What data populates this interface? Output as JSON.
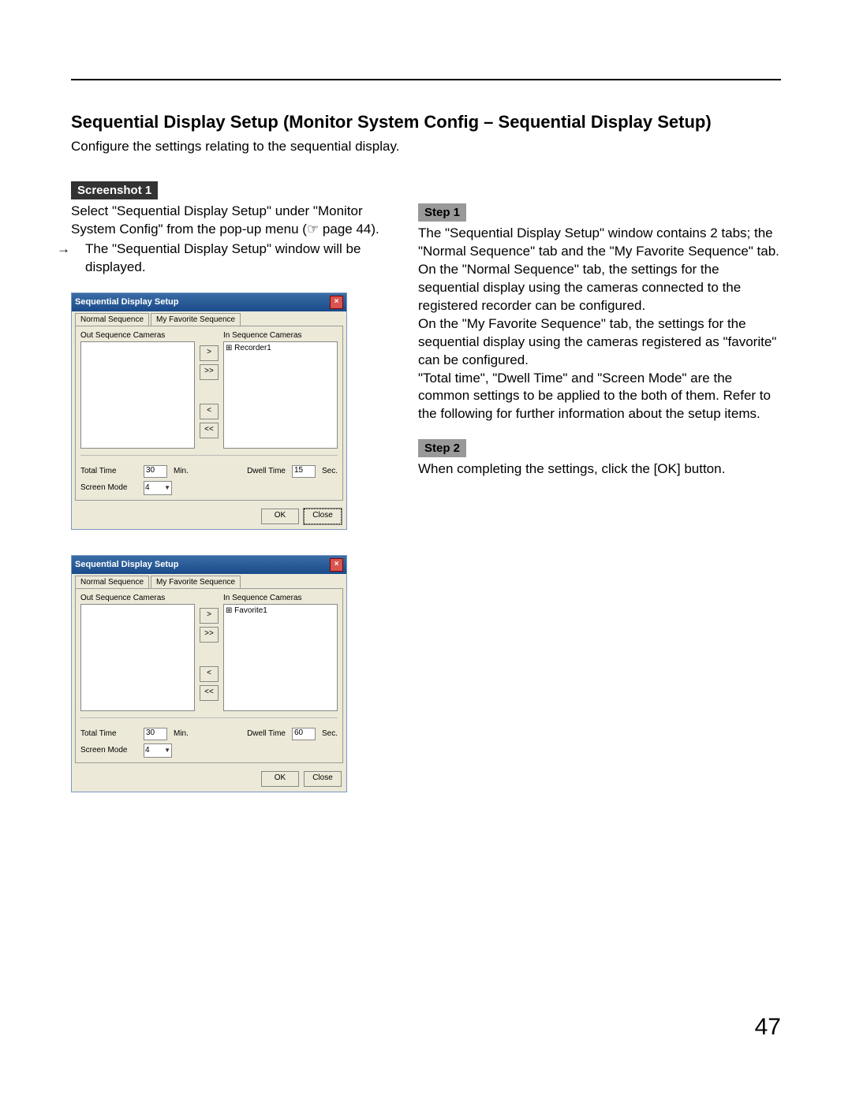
{
  "page": {
    "section_title": "Sequential Display Setup (Monitor System Config – Sequential Display Setup)",
    "intro": "Configure the settings relating to the sequential display.",
    "page_number": "47"
  },
  "screenshot_tag": "Screenshot 1",
  "screenshot_text_a": "Select \"Sequential Display Setup\" under \"Monitor System Config\" from the pop-up menu (☞ page 44).",
  "screenshot_text_b": "The \"Sequential Display Setup\" window will be displayed.",
  "step1_tag": "Step 1",
  "step1_text": "The \"Sequential Display Setup\" window contains 2 tabs; the \"Normal Sequence\" tab and the \"My Favorite Sequence\" tab.\nOn the \"Normal Sequence\" tab, the settings for the sequential display using the cameras connected to the registered recorder can be configured.\nOn the \"My Favorite Sequence\" tab, the settings for the sequential display using the cameras registered as \"favorite\" can be configured.\n\"Total time\", \"Dwell Time\" and \"Screen Mode\" are the common settings to be applied to the both of them. Refer to the following for further information about the setup items.",
  "step2_tag": "Step 2",
  "step2_text": "When completing the settings, click the [OK] button.",
  "dialog": {
    "title": "Sequential Display Setup",
    "tab_normal": "Normal Sequence",
    "tab_favorite": "My Favorite Sequence",
    "out_label": "Out Sequence Cameras",
    "in_label": "In Sequence Cameras",
    "tree_recorder": "Recorder1",
    "tree_favorite": "Favorite1",
    "btn_right": ">",
    "btn_right_all": ">>",
    "btn_left": "<",
    "btn_left_all": "<<",
    "total_time": "Total Time",
    "total_time_val1": "30",
    "total_time_unit": "Min.",
    "dwell_time": "Dwell Time",
    "dwell_time_val1": "15",
    "dwell_time_val2": "60",
    "dwell_time_unit": "Sec.",
    "screen_mode": "Screen Mode",
    "screen_mode_val": "4",
    "ok": "OK",
    "close": "Close"
  }
}
